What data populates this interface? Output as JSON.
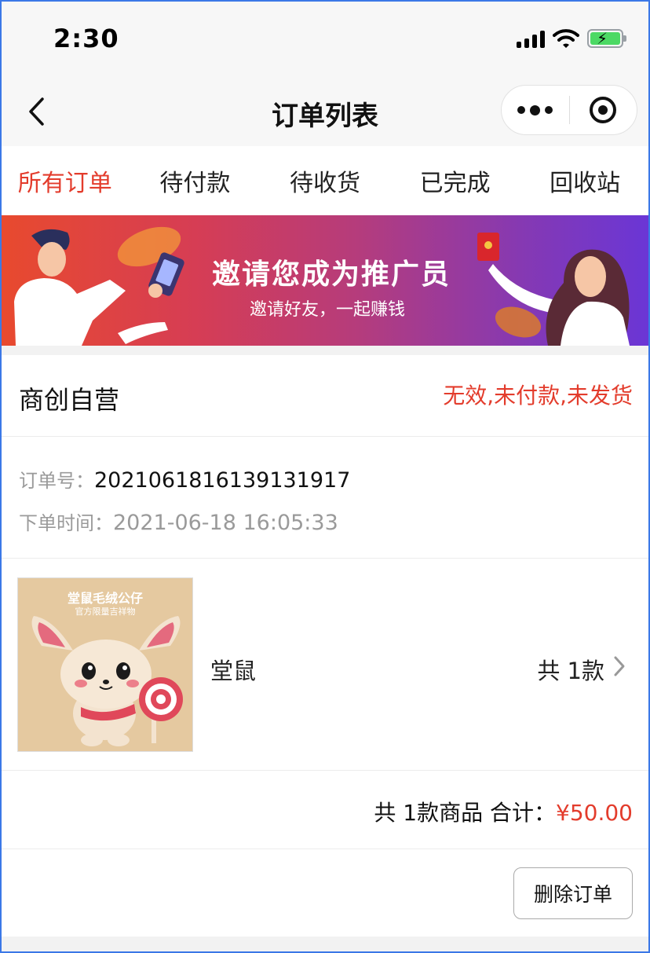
{
  "status_bar": {
    "time": "2:30"
  },
  "nav": {
    "title": "订单列表"
  },
  "tabs": [
    {
      "label": "所有订单",
      "active": true
    },
    {
      "label": "待付款",
      "active": false
    },
    {
      "label": "待收货",
      "active": false
    },
    {
      "label": "已完成",
      "active": false
    },
    {
      "label": "回收站",
      "active": false
    }
  ],
  "banner": {
    "title": "邀请您成为推广员",
    "subtitle": "邀请好友，一起赚钱"
  },
  "order": {
    "shop_name": "商创自营",
    "status": "无效,未付款,未发货",
    "order_no_label": "订单号：",
    "order_no": "2021061816139131917",
    "time_label": "下单时间：",
    "time": "2021-06-18 16:05:33",
    "product": {
      "image_title": "堂鼠毛绒公仔",
      "image_subtitle": "官方限量吉祥物",
      "name": "堂鼠",
      "count": "共 1款"
    },
    "total_summary": "共 1款商品 合计：",
    "total_price": "¥50.00",
    "delete_label": "删除订单"
  },
  "colors": {
    "accent_red": "#e33c2c",
    "frame_blue": "#3b78e7"
  }
}
